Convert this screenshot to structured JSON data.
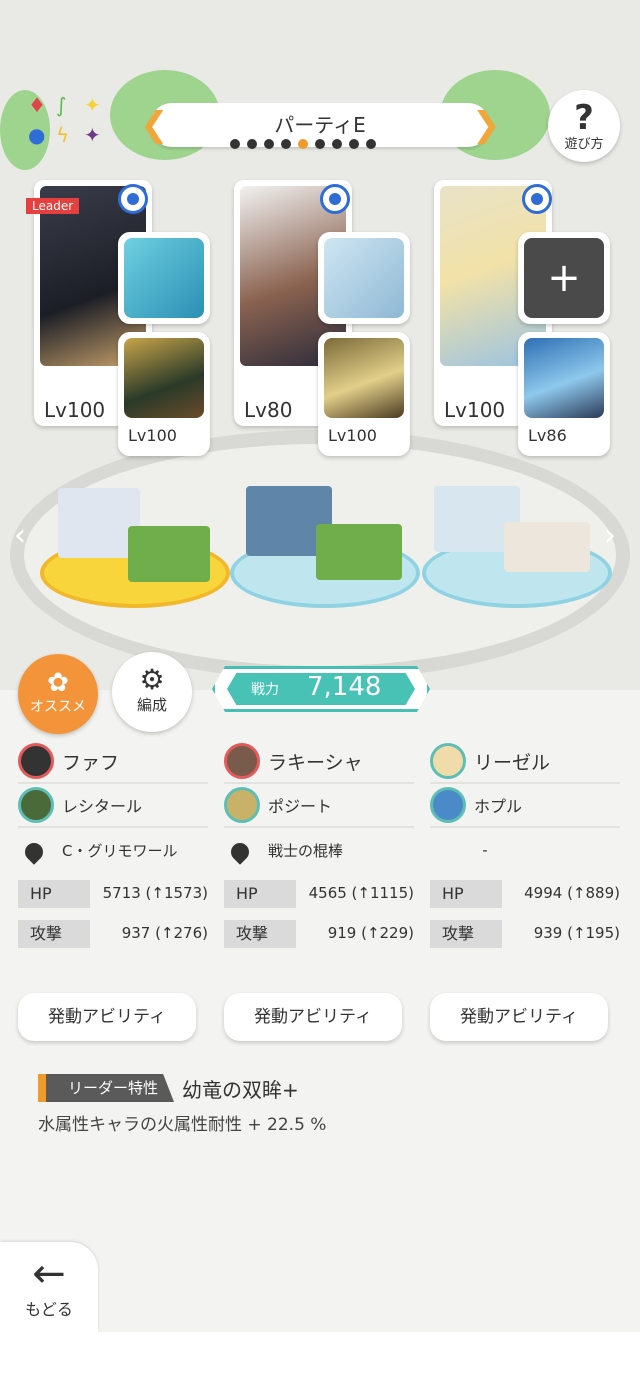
{
  "header": {
    "party_title": "パーティE",
    "party_dot_count": 9,
    "party_active_index": 4,
    "help_label": "遊び方",
    "help_symbol": "?"
  },
  "cards": [
    {
      "leader_tag": "Leader",
      "level": "Lv100",
      "sub_level": "Lv100"
    },
    {
      "level": "Lv80",
      "sub_level": "Lv100"
    },
    {
      "level": "Lv100",
      "sub_level": "Lv86"
    }
  ],
  "buttons": {
    "recommend_label": "オススメ",
    "formation_label": "編成"
  },
  "power": {
    "label": "戦力",
    "value": "7,148"
  },
  "columns": [
    {
      "main": "ファフ",
      "sub": "レシタール",
      "equip": "C・グリモワール",
      "hp_label": "HP",
      "hp": "5713 (↑1573)",
      "atk_label": "攻撃",
      "atk": "937 (↑276)",
      "ability": "発動アビリティ"
    },
    {
      "main": "ラキーシャ",
      "sub": "ポジート",
      "equip": "戦士の棍棒",
      "hp_label": "HP",
      "hp": "4565 (↑1115)",
      "atk_label": "攻撃",
      "atk": "919 (↑229)",
      "ability": "発動アビリティ"
    },
    {
      "main": "リーゼル",
      "sub": "ホプル",
      "equip": "-",
      "hp_label": "HP",
      "hp": "4994 (↑889)",
      "atk_label": "攻撃",
      "atk": "939 (↑195)",
      "ability": "発動アビリティ"
    }
  ],
  "leader_skill": {
    "label": "リーダー特性",
    "name": "幼竜の双眸+",
    "description": "水属性キャラの火属性耐性 + 22.5 %"
  },
  "back": {
    "label": "もどる",
    "icon": "←"
  },
  "colors": {
    "accent": "#f19a2c",
    "teal": "#49c2b6",
    "leader_red": "#e6403e",
    "radio_blue": "#2f6cd6"
  }
}
